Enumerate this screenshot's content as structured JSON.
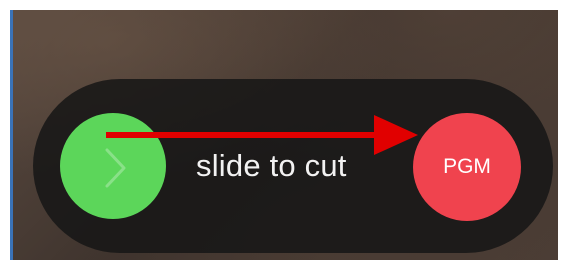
{
  "slider": {
    "label": "slide to cut",
    "target_label": "PGM",
    "knob_icon": "chevron-right-icon",
    "colors": {
      "knob": "#5cd65a",
      "target": "#f0434e",
      "track": "#161616",
      "annotation_arrow": "#e10000"
    }
  }
}
